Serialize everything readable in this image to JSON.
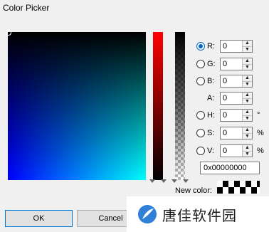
{
  "window": {
    "title": "Color Picker"
  },
  "channels": [
    {
      "key": "R",
      "label": "R:",
      "value": "0",
      "unit": "",
      "has_radio": true,
      "selected": true
    },
    {
      "key": "G",
      "label": "G:",
      "value": "0",
      "unit": "",
      "has_radio": true,
      "selected": false
    },
    {
      "key": "B",
      "label": "B:",
      "value": "0",
      "unit": "",
      "has_radio": true,
      "selected": false
    },
    {
      "key": "A",
      "label": "A:",
      "value": "0",
      "unit": "",
      "has_radio": false,
      "selected": false
    },
    {
      "key": "H",
      "label": "H:",
      "value": "0",
      "unit": "°",
      "has_radio": true,
      "selected": false
    },
    {
      "key": "S",
      "label": "S:",
      "value": "0",
      "unit": "%",
      "has_radio": true,
      "selected": false
    },
    {
      "key": "V",
      "label": "V:",
      "value": "0",
      "unit": "%",
      "has_radio": true,
      "selected": false
    }
  ],
  "hex": {
    "value": "0x00000000"
  },
  "new_color": {
    "label": "New color:"
  },
  "buttons": {
    "ok": "OK",
    "cancel": "Cancel"
  },
  "watermark": {
    "text": "唐佳软件园"
  },
  "colors": {
    "accent": "#0078d7",
    "radio": "#0066cc"
  },
  "icons": {
    "spin_up": "up-arrow-icon",
    "spin_down": "down-arrow-icon",
    "logo": "feather-logo-icon"
  }
}
